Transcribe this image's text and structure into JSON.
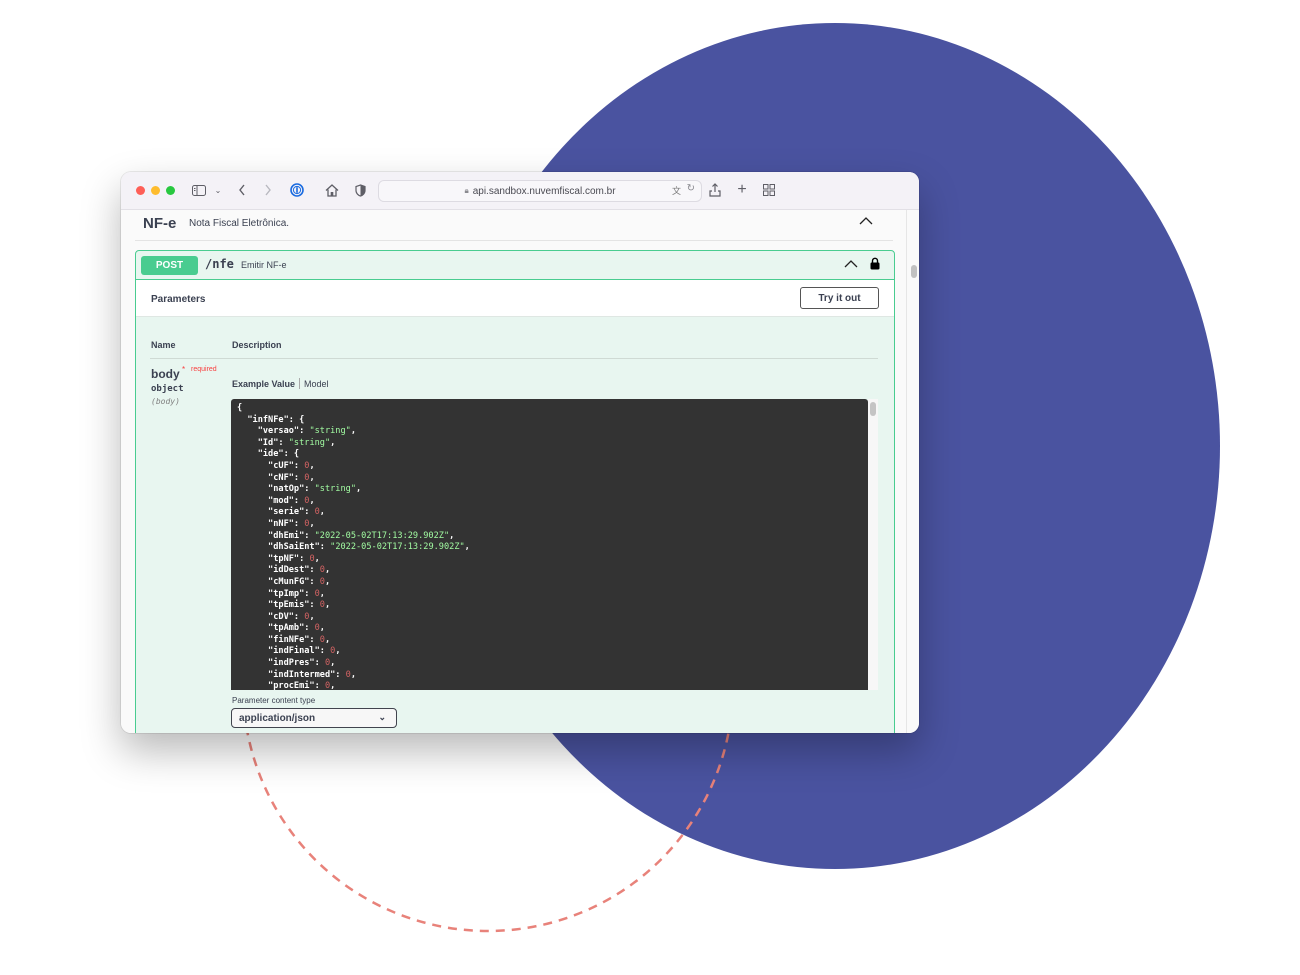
{
  "browser": {
    "url": "api.sandbox.nuvemfiscal.com.br",
    "buttons": [
      "sidebar-toggle",
      "back",
      "forward",
      "password-manager",
      "home",
      "privacy",
      "translate",
      "reload",
      "share",
      "new-tab",
      "tab-overview"
    ]
  },
  "tag": {
    "title": "NF-e",
    "description": "Nota Fiscal Eletrônica."
  },
  "operation": {
    "method": "POST",
    "path": "/nfe",
    "summary": "Emitir NF-e",
    "method_color": "#49cc90"
  },
  "parameters": {
    "title": "Parameters",
    "try_it_out": "Try it out",
    "col_name": "Name",
    "col_description": "Description",
    "param": {
      "name": "body",
      "required_star": "*",
      "required_label": "required",
      "type": "object",
      "in": "(body)"
    },
    "example_tab": "Example Value",
    "model_tab": "Model",
    "content_type_label": "Parameter content type",
    "content_type_value": "application/json"
  },
  "example_json": [
    {
      "indent": 0,
      "text": "{"
    },
    {
      "indent": 1,
      "key": "infNFe",
      "open": "{"
    },
    {
      "indent": 2,
      "key": "versao",
      "str": "string"
    },
    {
      "indent": 2,
      "key": "Id",
      "str": "string"
    },
    {
      "indent": 2,
      "key": "ide",
      "open": "{"
    },
    {
      "indent": 3,
      "key": "cUF",
      "num": "0"
    },
    {
      "indent": 3,
      "key": "cNF",
      "num": "0"
    },
    {
      "indent": 3,
      "key": "natOp",
      "str": "string"
    },
    {
      "indent": 3,
      "key": "mod",
      "num": "0"
    },
    {
      "indent": 3,
      "key": "serie",
      "num": "0"
    },
    {
      "indent": 3,
      "key": "nNF",
      "num": "0"
    },
    {
      "indent": 3,
      "key": "dhEmi",
      "str": "2022-05-02T17:13:29.902Z"
    },
    {
      "indent": 3,
      "key": "dhSaiEnt",
      "str": "2022-05-02T17:13:29.902Z"
    },
    {
      "indent": 3,
      "key": "tpNF",
      "num": "0"
    },
    {
      "indent": 3,
      "key": "idDest",
      "num": "0"
    },
    {
      "indent": 3,
      "key": "cMunFG",
      "num": "0"
    },
    {
      "indent": 3,
      "key": "tpImp",
      "num": "0"
    },
    {
      "indent": 3,
      "key": "tpEmis",
      "num": "0"
    },
    {
      "indent": 3,
      "key": "cDV",
      "num": "0"
    },
    {
      "indent": 3,
      "key": "tpAmb",
      "num": "0"
    },
    {
      "indent": 3,
      "key": "finNFe",
      "num": "0"
    },
    {
      "indent": 3,
      "key": "indFinal",
      "num": "0"
    },
    {
      "indent": 3,
      "key": "indPres",
      "num": "0"
    },
    {
      "indent": 3,
      "key": "indIntermed",
      "num": "0"
    },
    {
      "indent": 3,
      "key": "procEmi",
      "num": "0"
    }
  ],
  "colors": {
    "background_circle": "#4a53a0",
    "dashed_circle": "#e8827a",
    "code_string": "#a2fca2",
    "code_number": "#d36363"
  }
}
